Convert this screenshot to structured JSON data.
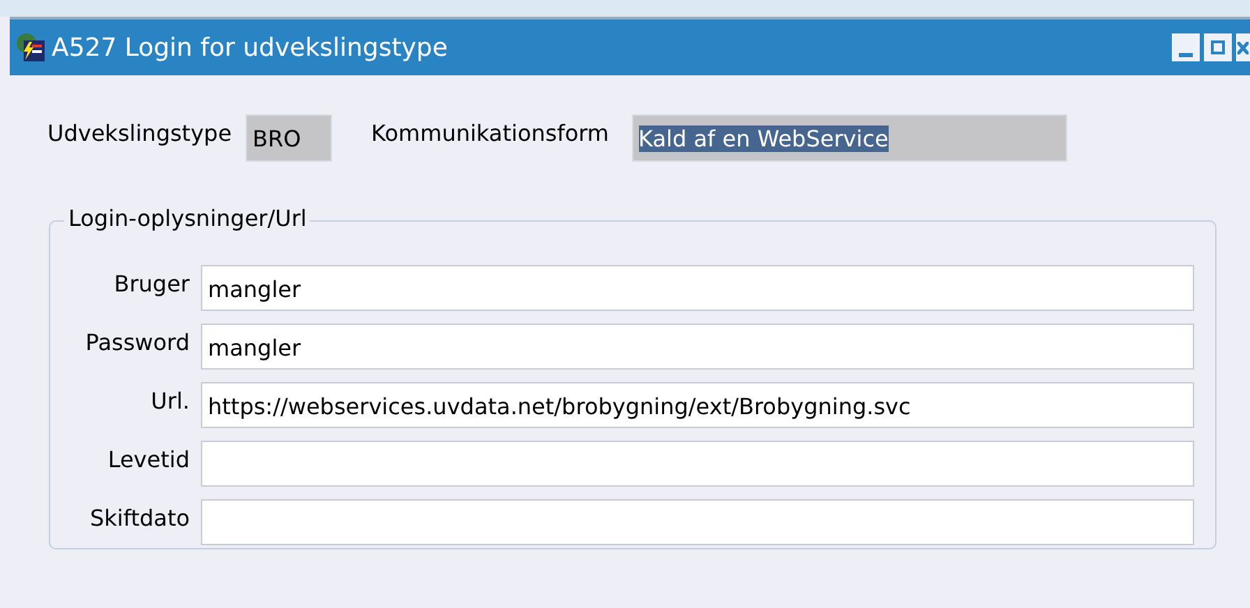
{
  "window": {
    "title": "A527 Login for udvekslingstype"
  },
  "header_fields": [
    {
      "label": "Udvekslingstype",
      "value": "BRO",
      "highlighted": false,
      "kind": "short"
    },
    {
      "label": "Kommunikationsform",
      "value": "Kald af en WebService",
      "highlighted": true,
      "kind": "long"
    }
  ],
  "group": {
    "title": "Login-oplysninger/Url",
    "fields": [
      {
        "label": "Bruger",
        "value": "mangler"
      },
      {
        "label": "Password",
        "value": "mangler"
      },
      {
        "label": "Url.",
        "value": "https://webservices.uvdata.net/brobygning/ext/Brobygning.svc"
      },
      {
        "label": "Levetid"
      },
      {
        "label": "Skiftdato"
      }
    ]
  }
}
